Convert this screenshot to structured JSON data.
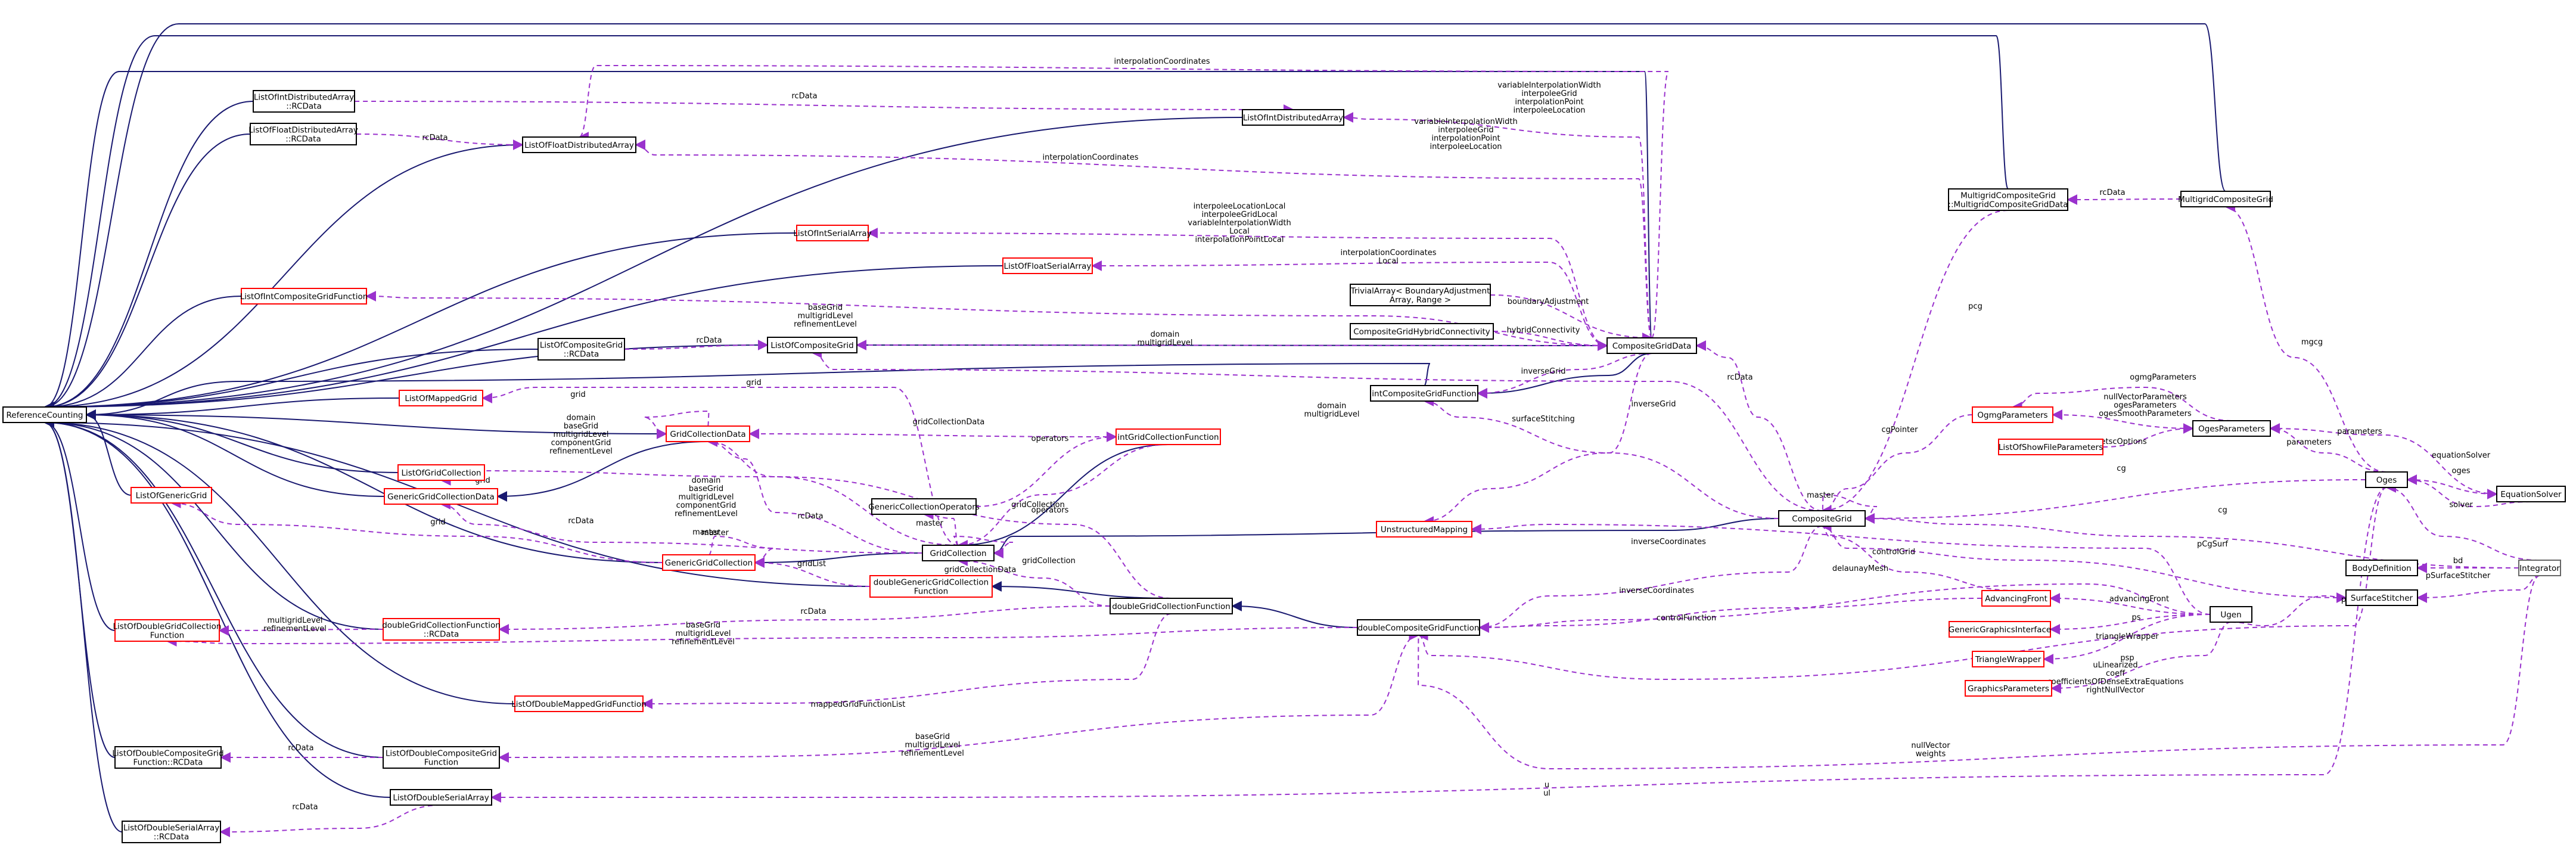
{
  "nodes": [
    {
      "id": "RC",
      "lines": [
        "ReferenceCounting"
      ],
      "color": "black"
    },
    {
      "id": "LIDA_RC",
      "lines": [
        "ListOfIntDistributedArray",
        "::RCData"
      ],
      "color": "black"
    },
    {
      "id": "LFDA_RC",
      "lines": [
        "ListOfFloatDistributedArray",
        "::RCData"
      ],
      "color": "black"
    },
    {
      "id": "LFDA",
      "lines": [
        "ListOfFloatDistributedArray"
      ],
      "color": "black"
    },
    {
      "id": "LIDA",
      "lines": [
        "ListOfIntDistributedArray"
      ],
      "color": "black"
    },
    {
      "id": "LISA",
      "lines": [
        "ListOfIntSerialArray"
      ],
      "color": "red"
    },
    {
      "id": "LFSA",
      "lines": [
        "ListOfFloatSerialArray"
      ],
      "color": "red"
    },
    {
      "id": "LICGF",
      "lines": [
        "ListOfIntCompositeGridFunction"
      ],
      "color": "red"
    },
    {
      "id": "LCG_RC",
      "lines": [
        "ListOfCompositeGrid",
        "::RCData"
      ],
      "color": "black"
    },
    {
      "id": "LCG",
      "lines": [
        "ListOfCompositeGrid"
      ],
      "color": "black"
    },
    {
      "id": "LMG",
      "lines": [
        "ListOfMappedGrid"
      ],
      "color": "red"
    },
    {
      "id": "GCD",
      "lines": [
        "GridCollectionData"
      ],
      "color": "red"
    },
    {
      "id": "LGC",
      "lines": [
        "ListOfGridCollection"
      ],
      "color": "red"
    },
    {
      "id": "GGCD",
      "lines": [
        "GenericGridCollectionData"
      ],
      "color": "red"
    },
    {
      "id": "LGG",
      "lines": [
        "ListOfGenericGrid"
      ],
      "color": "red"
    },
    {
      "id": "GGC",
      "lines": [
        "GenericGridCollection"
      ],
      "color": "red"
    },
    {
      "id": "GC",
      "lines": [
        "GridCollection"
      ],
      "color": "black"
    },
    {
      "id": "GCO",
      "lines": [
        "GenericCollectionOperators"
      ],
      "color": "black"
    },
    {
      "id": "IGCF",
      "lines": [
        "intGridCollectionFunction"
      ],
      "color": "red"
    },
    {
      "id": "ICGF",
      "lines": [
        "intCompositeGridFunction"
      ],
      "color": "black"
    },
    {
      "id": "DGGCF",
      "lines": [
        "doubleGenericGridCollection",
        "Function"
      ],
      "color": "red"
    },
    {
      "id": "DGCF",
      "lines": [
        "doubleGridCollectionFunction"
      ],
      "color": "black"
    },
    {
      "id": "LDGCF",
      "lines": [
        "ListOfDoubleGridCollection",
        "Function"
      ],
      "color": "red"
    },
    {
      "id": "DGCF_RC",
      "lines": [
        "doubleGridCollectionFunction",
        "::RCData"
      ],
      "color": "red"
    },
    {
      "id": "LDMGF",
      "lines": [
        "ListOfDoubleMappedGridFunction"
      ],
      "color": "red"
    },
    {
      "id": "LDCGF_RC",
      "lines": [
        "ListOfDoubleCompositeGrid",
        "Function::RCData"
      ],
      "color": "black"
    },
    {
      "id": "LDCGF",
      "lines": [
        "ListOfDoubleCompositeGrid",
        "Function"
      ],
      "color": "black"
    },
    {
      "id": "LDSA",
      "lines": [
        "ListOfDoubleSerialArray"
      ],
      "color": "black"
    },
    {
      "id": "LDSA_RC",
      "lines": [
        "ListOfDoubleSerialArray",
        "::RCData"
      ],
      "color": "black"
    },
    {
      "id": "TBA",
      "lines": [
        "TrivialArray< BoundaryAdjustment",
        "Array, Range >"
      ],
      "color": "black"
    },
    {
      "id": "CGHC",
      "lines": [
        "CompositeGridHybridConnectivity"
      ],
      "color": "black"
    },
    {
      "id": "CGD",
      "lines": [
        "CompositeGridData"
      ],
      "color": "black"
    },
    {
      "id": "UM",
      "lines": [
        "UnstructuredMapping"
      ],
      "color": "red"
    },
    {
      "id": "DCGF",
      "lines": [
        "doubleCompositeGridFunction"
      ],
      "color": "black"
    },
    {
      "id": "CG",
      "lines": [
        "CompositeGrid"
      ],
      "color": "black"
    },
    {
      "id": "MCGD",
      "lines": [
        "MultigridCompositeGrid",
        "::MultigridCompositeGridData"
      ],
      "color": "black"
    },
    {
      "id": "MCG",
      "lines": [
        "MultigridCompositeGrid"
      ],
      "color": "black"
    },
    {
      "id": "OGMP",
      "lines": [
        "OgmgParameters"
      ],
      "color": "red"
    },
    {
      "id": "LSFP",
      "lines": [
        "ListOfShowFileParameters"
      ],
      "color": "red"
    },
    {
      "id": "OGP",
      "lines": [
        "OgesParameters"
      ],
      "color": "black"
    },
    {
      "id": "OGES",
      "lines": [
        "Oges"
      ],
      "color": "black"
    },
    {
      "id": "ES",
      "lines": [
        "EquationSolver"
      ],
      "color": "black"
    },
    {
      "id": "AF",
      "lines": [
        "AdvancingFront"
      ],
      "color": "red"
    },
    {
      "id": "GGI",
      "lines": [
        "GenericGraphicsInterface"
      ],
      "color": "red"
    },
    {
      "id": "TW",
      "lines": [
        "TriangleWrapper"
      ],
      "color": "red"
    },
    {
      "id": "GP",
      "lines": [
        "GraphicsParameters"
      ],
      "color": "red"
    },
    {
      "id": "UGEN",
      "lines": [
        "Ugen"
      ],
      "color": "black"
    },
    {
      "id": "BD",
      "lines": [
        "BodyDefinition"
      ],
      "color": "black"
    },
    {
      "id": "SS",
      "lines": [
        "SurfaceStitcher"
      ],
      "color": "black"
    },
    {
      "id": "INT",
      "lines": [
        "Integrator"
      ],
      "color": "grey"
    }
  ],
  "edge_labels": [
    {
      "id": "l1",
      "lines": [
        "rcData"
      ]
    },
    {
      "id": "l2",
      "lines": [
        "rcData"
      ]
    },
    {
      "id": "l3",
      "lines": [
        "interpolationCoordinates"
      ]
    },
    {
      "id": "l4",
      "lines": [
        "variableInterpolationWidth",
        "interpoleeGrid",
        "interpolationPoint",
        "interpoleeLocation"
      ]
    },
    {
      "id": "l5",
      "lines": [
        "variableInterpolationWidth",
        "interpoleeGrid",
        "interpolationPoint",
        "interpoleeLocation"
      ]
    },
    {
      "id": "l6",
      "lines": [
        "interpolationCoordinates"
      ]
    },
    {
      "id": "l7",
      "lines": [
        "interpoleeLocationLocal",
        "interpoleeGridLocal",
        "variableInterpolationWidth",
        "Local",
        "interpolationPointLocal"
      ]
    },
    {
      "id": "l8",
      "lines": [
        "interpolationCoordinates",
        "Local"
      ]
    },
    {
      "id": "l9",
      "lines": [
        "baseGrid",
        "multigridLevel",
        "refinementLevel"
      ]
    },
    {
      "id": "l10",
      "lines": [
        "boundaryAdjustment"
      ]
    },
    {
      "id": "l11",
      "lines": [
        "rcData"
      ]
    },
    {
      "id": "l12",
      "lines": [
        "domain",
        "multigridLevel"
      ]
    },
    {
      "id": "l13",
      "lines": [
        "hybridConnectivity"
      ]
    },
    {
      "id": "l14",
      "lines": [
        "grid"
      ]
    },
    {
      "id": "l15",
      "lines": [
        "grid"
      ]
    },
    {
      "id": "l16",
      "lines": [
        "inverseGrid"
      ]
    },
    {
      "id": "l17",
      "lines": [
        "gridCollectionData"
      ]
    },
    {
      "id": "l18",
      "lines": [
        "domain",
        "multigridLevel"
      ]
    },
    {
      "id": "l19",
      "lines": [
        "domain",
        "baseGrid",
        "multigridLevel",
        "componentGrid",
        "refinementLevel"
      ]
    },
    {
      "id": "l20",
      "lines": [
        "grid"
      ]
    },
    {
      "id": "l21",
      "lines": [
        "operators"
      ]
    },
    {
      "id": "l22",
      "lines": [
        "surfaceStitching"
      ]
    },
    {
      "id": "l23",
      "lines": [
        "inverseGrid"
      ]
    },
    {
      "id": "l24",
      "lines": [
        "domain",
        "baseGrid",
        "multigridLevel",
        "componentGrid",
        "refinementLevel"
      ]
    },
    {
      "id": "l25",
      "lines": [
        "rcData"
      ]
    },
    {
      "id": "l26",
      "lines": [
        "gridCollection"
      ]
    },
    {
      "id": "l27",
      "lines": [
        "grid"
      ]
    },
    {
      "id": "l28",
      "lines": [
        "rcData"
      ]
    },
    {
      "id": "l29",
      "lines": [
        "master"
      ]
    },
    {
      "id": "l30",
      "lines": [
        "master"
      ]
    },
    {
      "id": "l31",
      "lines": [
        "operators"
      ]
    },
    {
      "id": "l32",
      "lines": [
        "gridCollectionData"
      ]
    },
    {
      "id": "l33",
      "lines": [
        "master"
      ]
    },
    {
      "id": "l34",
      "lines": [
        "gridList"
      ]
    },
    {
      "id": "l35",
      "lines": [
        "gridCollection"
      ]
    },
    {
      "id": "l36",
      "lines": [
        "multigridLevel",
        "refinementLevel"
      ]
    },
    {
      "id": "l37",
      "lines": [
        "rcData"
      ]
    },
    {
      "id": "l38",
      "lines": [
        "baseGrid",
        "multigridLevel",
        "refinementLevel"
      ]
    },
    {
      "id": "l39",
      "lines": [
        "mappedGridFunctionList"
      ]
    },
    {
      "id": "l40",
      "lines": [
        "rcData"
      ]
    },
    {
      "id": "l41",
      "lines": [
        "baseGrid",
        "multigridLevel",
        "refinementLevel"
      ]
    },
    {
      "id": "l42",
      "lines": [
        "rcData"
      ]
    },
    {
      "id": "l43",
      "lines": [
        "u",
        "ul"
      ]
    },
    {
      "id": "l44",
      "lines": [
        "inverseCoordinates"
      ]
    },
    {
      "id": "l45",
      "lines": [
        "inverseCoordinates"
      ]
    },
    {
      "id": "l46",
      "lines": [
        "rcData"
      ]
    },
    {
      "id": "l47",
      "lines": [
        "pcg"
      ]
    },
    {
      "id": "l48",
      "lines": [
        "rcData"
      ]
    },
    {
      "id": "l49",
      "lines": [
        "mgcg"
      ]
    },
    {
      "id": "l50",
      "lines": [
        "cgPointer"
      ]
    },
    {
      "id": "l51",
      "lines": [
        "ogmgParameters"
      ]
    },
    {
      "id": "l52",
      "lines": [
        "nullVectorParameters",
        "ogesParameters",
        "ogesSmoothParameters"
      ]
    },
    {
      "id": "l53",
      "lines": [
        "petscOptions"
      ]
    },
    {
      "id": "l54",
      "lines": [
        "parameters"
      ]
    },
    {
      "id": "l55",
      "lines": [
        "parameters"
      ]
    },
    {
      "id": "l56",
      "lines": [
        "equationSolver"
      ]
    },
    {
      "id": "l57",
      "lines": [
        "oges"
      ]
    },
    {
      "id": "l58",
      "lines": [
        "solver"
      ]
    },
    {
      "id": "l59",
      "lines": [
        "cg"
      ]
    },
    {
      "id": "l60",
      "lines": [
        "cg"
      ]
    },
    {
      "id": "l61",
      "lines": [
        "pCgSurf"
      ]
    },
    {
      "id": "l62",
      "lines": [
        "pSurfaceStitcher"
      ]
    },
    {
      "id": "l63",
      "lines": [
        "bd"
      ]
    },
    {
      "id": "l64",
      "lines": [
        "controlGrid"
      ]
    },
    {
      "id": "l65",
      "lines": [
        "delaunayMesh"
      ]
    },
    {
      "id": "l66",
      "lines": [
        "pUgen"
      ]
    },
    {
      "id": "l67",
      "lines": [
        "advancingFront"
      ]
    },
    {
      "id": "l68",
      "lines": [
        "controlFunction"
      ]
    },
    {
      "id": "l69",
      "lines": [
        "ps"
      ]
    },
    {
      "id": "l70",
      "lines": [
        "triangleWrapper"
      ]
    },
    {
      "id": "l71",
      "lines": [
        "psp"
      ]
    },
    {
      "id": "l72",
      "lines": [
        "uLinearized",
        "coeff",
        "coefficientsOfDenseExtraEquations",
        "rightNullVector"
      ]
    },
    {
      "id": "l73",
      "lines": [
        "nullVector",
        "weights"
      ]
    },
    {
      "id": "l74",
      "lines": [
        "master"
      ]
    }
  ],
  "colors": {
    "inheritance": "#191970",
    "usage": "#9a32cd",
    "node_border_black": "#000000",
    "node_border_red": "#ff0000",
    "node_border_grey": "#bfbfbf",
    "node_fill_grey": "#bfbfbf",
    "background": "#ffffff"
  }
}
